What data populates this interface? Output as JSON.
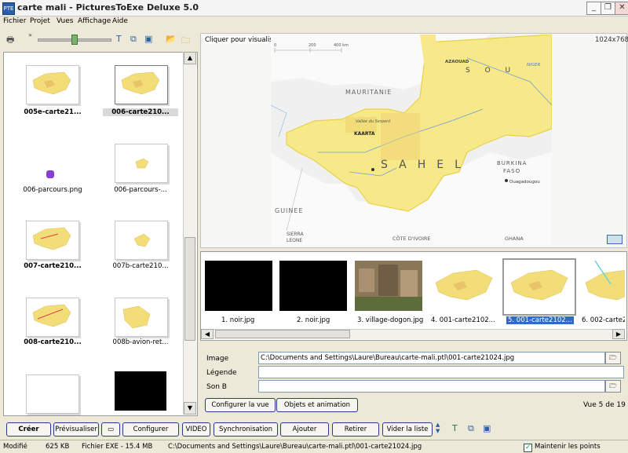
{
  "window": {
    "title": "carte mali - PicturesToExe Deluxe 5.0",
    "app_icon": "PTE"
  },
  "menu": [
    "Fichier",
    "Projet",
    "Vues",
    "Affichage",
    "Aide"
  ],
  "left_panel": {
    "items": [
      {
        "label": "005e-carte21...",
        "kind": "map",
        "selected": false
      },
      {
        "label": "006-carte210...",
        "kind": "map",
        "selected": true
      },
      {
        "label": "006-parcours.png",
        "kind": "dot"
      },
      {
        "label": "006-parcours-...",
        "kind": "spot"
      },
      {
        "label": "007-carte210...",
        "kind": "map"
      },
      {
        "label": "007b-carte210...",
        "kind": "spot"
      },
      {
        "label": "008-carte210...",
        "kind": "map"
      },
      {
        "label": "008b-avion-ret...",
        "kind": "map"
      },
      {
        "label": "",
        "kind": "white"
      },
      {
        "label": "",
        "kind": "black"
      }
    ]
  },
  "preview": {
    "hint": "Cliquer pour visualiser plein écran",
    "resolution": "1024x768"
  },
  "map_labels": {
    "mauritanie": "MAURITANIE",
    "sahel": "SAHEL",
    "guinee": "GUINEE",
    "burkina": "BURKINA",
    "faso": "FASO",
    "ouagadougou": "Ouagadougou",
    "cote_ivoire": "CÔTE D'IVOIRE",
    "ghana": "GHANA",
    "sierra": "SIERRA",
    "leone": "LEONE",
    "kaarta": "KAARTA",
    "vallee": "Vallée du Serpent",
    "soudan": "S O U",
    "azaouad": "AZAOUAD",
    "niger": "NIGER",
    "scale_0": "0",
    "scale_200": "200",
    "scale_400": "400 km"
  },
  "strip": {
    "items": [
      {
        "label": "1. noir.jpg",
        "kind": "black"
      },
      {
        "label": "2. noir.jpg",
        "kind": "black"
      },
      {
        "label": "3. village-dogon.jpg",
        "kind": "photo"
      },
      {
        "label": "4. 001-carte2102...",
        "kind": "map"
      },
      {
        "label": "5. 001-carte2102...",
        "kind": "map",
        "selected": true
      },
      {
        "label": "6. 002-carte21",
        "kind": "map"
      }
    ]
  },
  "properties": {
    "image_label": "Image",
    "image_value": "C:\\Documents and Settings\\Laure\\Bureau\\carte-mali.ptl\\001-carte21024.jpg",
    "legend_label": "Légende",
    "legend_value": "",
    "sound_label": "Son B",
    "sound_value": "",
    "configure_view": "Configurer la vue",
    "objects_animation": "Objets et animation",
    "slide_count": "Vue 5 de 19"
  },
  "bottom_toolbar": {
    "create": "Créer",
    "preview": "Prévisualiser",
    "configure": "Configurer",
    "video": "VIDEO",
    "sync": "Synchronisation",
    "add": "Ajouter",
    "remove": "Retirer",
    "empty_list": "Vider la liste"
  },
  "status": {
    "modified": "Modifié",
    "size": "625 KB",
    "exe_size": "Fichier EXE - 15.4 MB",
    "path": "C:\\Documents and Settings\\Laure\\Bureau\\carte-mali.ptl\\001-carte21024.jpg",
    "keep_points": "Maintenir les points",
    "keep_points_checked": "✓"
  },
  "colors": {
    "accent": "#316ac5",
    "map_yellow": "#f7e88a",
    "map_border": "#e6d24a"
  }
}
